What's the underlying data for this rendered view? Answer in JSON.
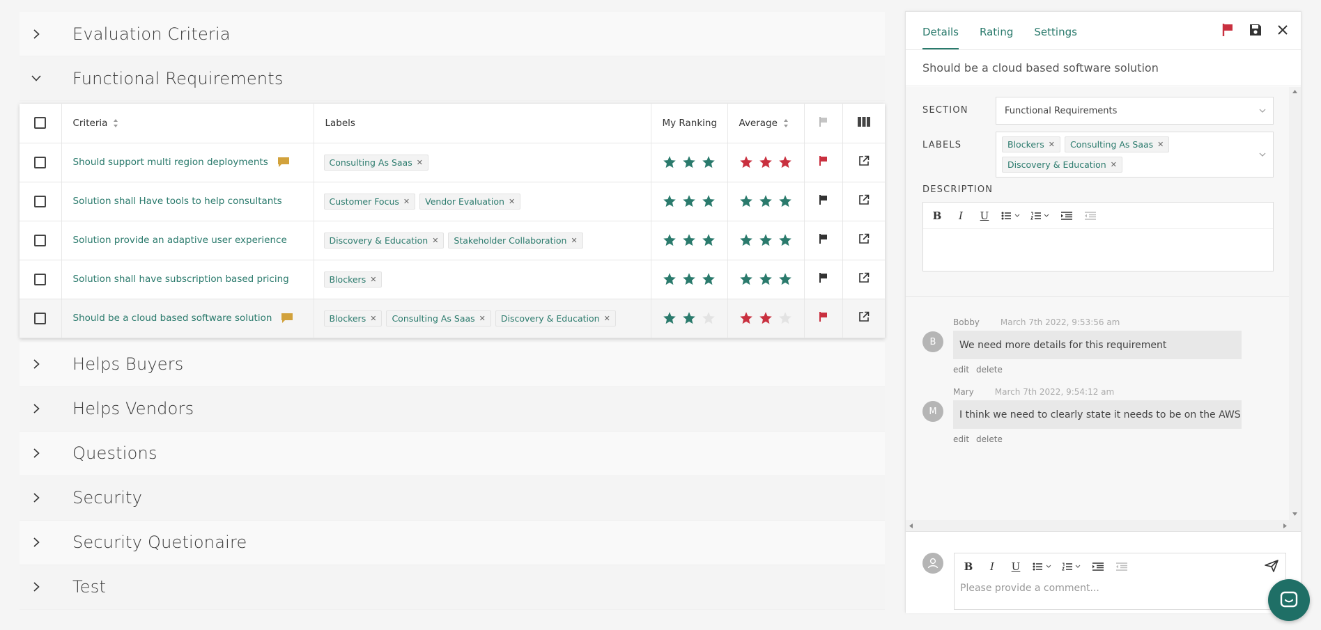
{
  "colors": {
    "accent": "#2a7a6c",
    "flag_red": "#c9303f",
    "comment_yellow": "#d2a23c",
    "star_empty": "#e3e3e3"
  },
  "sections_before": [
    {
      "title": "Evaluation Criteria",
      "expanded": false
    },
    {
      "title": "Functional Requirements",
      "expanded": true
    }
  ],
  "sections_after": [
    {
      "title": "Helps Buyers"
    },
    {
      "title": "Helps Vendors"
    },
    {
      "title": "Questions"
    },
    {
      "title": "Security"
    },
    {
      "title": "Security Quetionaire"
    },
    {
      "title": "Test"
    }
  ],
  "table": {
    "headers": {
      "criteria": "Criteria",
      "labels": "Labels",
      "my_ranking": "My Ranking",
      "average": "Average"
    },
    "rows": [
      {
        "criteria": "Should support multi region deployments",
        "has_comment": true,
        "labels": [
          "Consulting As Saas"
        ],
        "my_ranking": 3,
        "average": 3,
        "average_color": "red",
        "flag": "red"
      },
      {
        "criteria": "Solution shall Have tools to help consultants",
        "has_comment": false,
        "labels": [
          "Customer Focus",
          "Vendor Evaluation"
        ],
        "my_ranking": 3,
        "average": 3,
        "average_color": "green",
        "flag": "dark"
      },
      {
        "criteria": "Solution provide an adaptive user experience",
        "has_comment": false,
        "labels": [
          "Discovery & Education",
          "Stakeholder Collaboration"
        ],
        "my_ranking": 3,
        "average": 3,
        "average_color": "green",
        "flag": "dark"
      },
      {
        "criteria": "Solution shall have subscription based pricing",
        "has_comment": false,
        "labels": [
          "Blockers"
        ],
        "my_ranking": 3,
        "average": 3,
        "average_color": "green",
        "flag": "dark"
      },
      {
        "criteria": "Should be a cloud based software solution",
        "has_comment": true,
        "labels": [
          "Blockers",
          "Consulting As Saas",
          "Discovery & Education"
        ],
        "my_ranking": 2,
        "average": 2,
        "average_color": "red",
        "flag": "red"
      }
    ]
  },
  "panel": {
    "tabs": [
      "Details",
      "Rating",
      "Settings"
    ],
    "active_tab": "Details",
    "title": "Should be a cloud based software solution",
    "section_label": "SECTION",
    "section_value": "Functional Requirements",
    "labels_label": "LABELS",
    "labels": [
      "Blockers",
      "Consulting As Saas",
      "Discovery & Education"
    ],
    "description_label": "DESCRIPTION",
    "comments": [
      {
        "avatar": "B",
        "name": "Bobby",
        "date": "March 7th 2022, 9:53:56 am",
        "text": "We need more details for this requirement",
        "edit": "edit",
        "delete": "delete"
      },
      {
        "avatar": "M",
        "name": "Mary",
        "date": "March 7th 2022, 9:54:12 am",
        "text": "I think we need to clearly state it needs to be on the AWS",
        "edit": "edit",
        "delete": "delete"
      }
    ],
    "comment_placeholder": "Please provide a comment..."
  }
}
